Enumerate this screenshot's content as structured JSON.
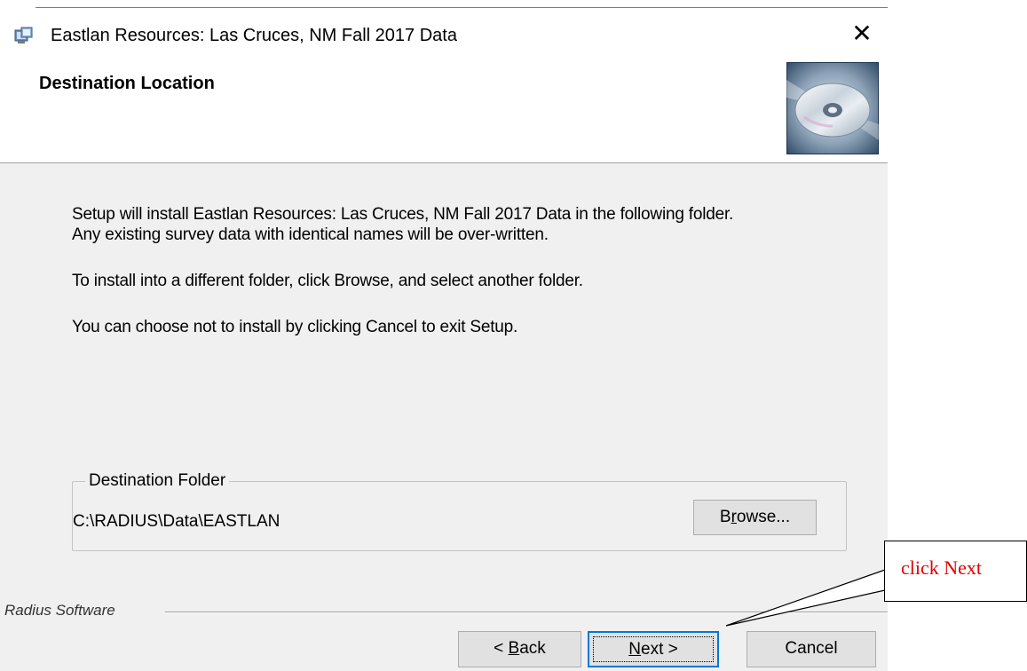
{
  "window": {
    "title": "Eastlan Resources: Las Cruces, NM Fall 2017 Data",
    "close_glyph": "✕"
  },
  "header": {
    "title": "Destination Location",
    "image": "cd-disc-icon"
  },
  "content": {
    "line1": "Setup will install Eastlan Resources: Las Cruces, NM Fall 2017 Data in the following folder.",
    "line2": "Any existing survey data with identical names will be over-written.",
    "line3": "To install into a different folder, click Browse, and select another folder.",
    "line4": "You can choose not to install  by clicking Cancel to exit Setup."
  },
  "destination": {
    "legend": "Destination Folder",
    "path": "C:\\RADIUS\\Data\\EASTLAN",
    "browse_pre": "B",
    "browse_ul": "r",
    "browse_post": "owse..."
  },
  "footer": {
    "brand": "Radius Software",
    "back_pre": "< ",
    "back_ul": "B",
    "back_post": "ack",
    "next_ul": "N",
    "next_post": "ext >",
    "cancel": "Cancel"
  },
  "annotation": {
    "text": "click Next",
    "color": "#e00000"
  }
}
